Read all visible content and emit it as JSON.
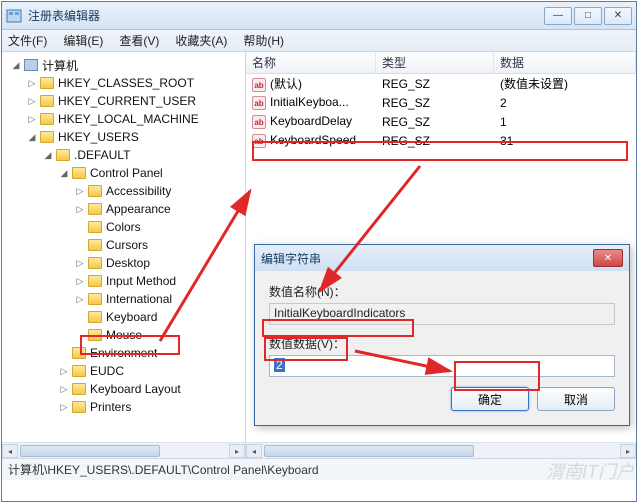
{
  "window": {
    "title": "注册表编辑器",
    "controls": {
      "min": "—",
      "max": "□",
      "close": "✕"
    }
  },
  "menubar": {
    "file": "文件(F)",
    "edit": "编辑(E)",
    "view": "查看(V)",
    "favorites": "收藏夹(A)",
    "help": "帮助(H)"
  },
  "tree": {
    "root": "计算机",
    "hkcr": "HKEY_CLASSES_ROOT",
    "hkcu": "HKEY_CURRENT_USER",
    "hklm": "HKEY_LOCAL_MACHINE",
    "hku": "HKEY_USERS",
    "default": ".DEFAULT",
    "cpl": "Control Panel",
    "items": {
      "accessibility": "Accessibility",
      "appearance": "Appearance",
      "colors": "Colors",
      "cursors": "Cursors",
      "desktop": "Desktop",
      "inputmethod": "Input Method",
      "international": "International",
      "keyboard": "Keyboard",
      "mouse": "Mouse"
    },
    "environment": "Environment",
    "eudc": "EUDC",
    "kbdlayout": "Keyboard Layout",
    "printers": "Printers"
  },
  "list": {
    "headers": {
      "name": "名称",
      "type": "类型",
      "data": "数据"
    },
    "rows": [
      {
        "name": "(默认)",
        "type": "REG_SZ",
        "data": "(数值未设置)"
      },
      {
        "name": "InitialKeyboa...",
        "type": "REG_SZ",
        "data": "2"
      },
      {
        "name": "KeyboardDelay",
        "type": "REG_SZ",
        "data": "1"
      },
      {
        "name": "KeyboardSpeed",
        "type": "REG_SZ",
        "data": "31"
      }
    ]
  },
  "dialog": {
    "title": "编辑字符串",
    "name_label": "数值名称(N)：",
    "name_value": "InitialKeyboardIndicators",
    "data_label": "数值数据(V)：",
    "data_value": "2",
    "ok": "确定",
    "cancel": "取消"
  },
  "statusbar": {
    "path": "计算机\\HKEY_USERS\\.DEFAULT\\Control Panel\\Keyboard"
  },
  "watermark": "渭南IT门户"
}
